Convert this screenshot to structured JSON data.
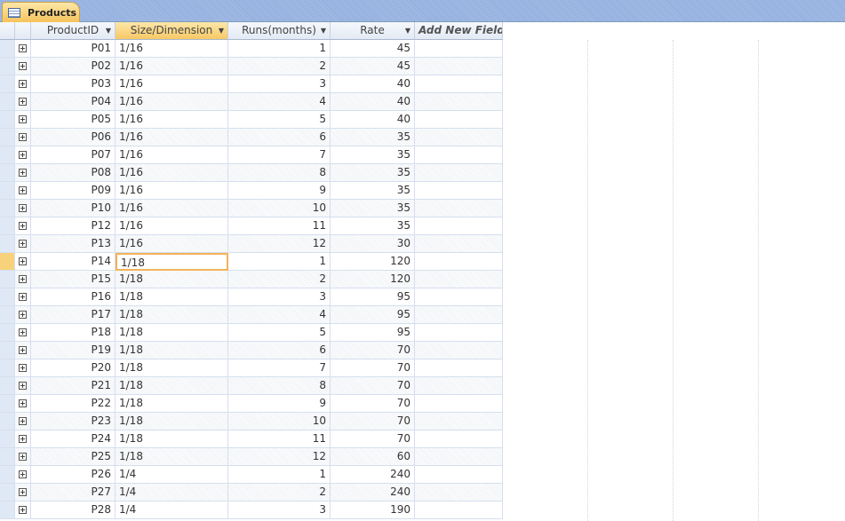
{
  "tab": {
    "title": "Products"
  },
  "columns": [
    "ProductID",
    "Size/Dimension",
    "Runs(months)",
    "Rate",
    "Add New Field"
  ],
  "current_row": "P14",
  "rows": [
    [
      "P01",
      "1/16",
      "1",
      "45"
    ],
    [
      "P02",
      "1/16",
      "2",
      "45"
    ],
    [
      "P03",
      "1/16",
      "3",
      "40"
    ],
    [
      "P04",
      "1/16",
      "4",
      "40"
    ],
    [
      "P05",
      "1/16",
      "5",
      "40"
    ],
    [
      "P06",
      "1/16",
      "6",
      "35"
    ],
    [
      "P07",
      "1/16",
      "7",
      "35"
    ],
    [
      "P08",
      "1/16",
      "8",
      "35"
    ],
    [
      "P09",
      "1/16",
      "9",
      "35"
    ],
    [
      "P10",
      "1/16",
      "10",
      "35"
    ],
    [
      "P12",
      "1/16",
      "11",
      "35"
    ],
    [
      "P13",
      "1/16",
      "12",
      "30"
    ],
    [
      "P14",
      "1/18",
      "1",
      "120"
    ],
    [
      "P15",
      "1/18",
      "2",
      "120"
    ],
    [
      "P16",
      "1/18",
      "3",
      "95"
    ],
    [
      "P17",
      "1/18",
      "4",
      "95"
    ],
    [
      "P18",
      "1/18",
      "5",
      "95"
    ],
    [
      "P19",
      "1/18",
      "6",
      "70"
    ],
    [
      "P20",
      "1/18",
      "7",
      "70"
    ],
    [
      "P21",
      "1/18",
      "8",
      "70"
    ],
    [
      "P22",
      "1/18",
      "9",
      "70"
    ],
    [
      "P23",
      "1/18",
      "10",
      "70"
    ],
    [
      "P24",
      "1/18",
      "11",
      "70"
    ],
    [
      "P25",
      "1/18",
      "12",
      "60"
    ],
    [
      "P26",
      "1/4",
      "1",
      "240"
    ],
    [
      "P27",
      "1/4",
      "2",
      "240"
    ],
    [
      "P28",
      "1/4",
      "3",
      "190"
    ]
  ]
}
